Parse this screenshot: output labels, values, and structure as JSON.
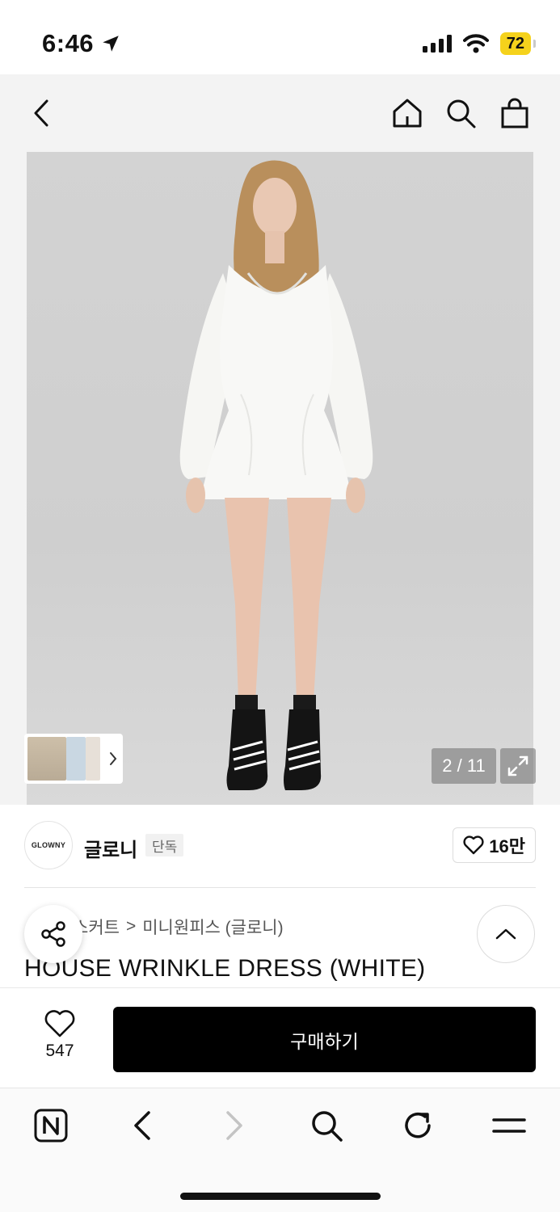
{
  "status_bar": {
    "time": "6:46",
    "battery": "72"
  },
  "gallery": {
    "counter": "2 / 11"
  },
  "brand": {
    "logo_text": "GLOWNY",
    "name": "글로니",
    "badge": "단독",
    "likes": "16만"
  },
  "breadcrumb": {
    "parts": [
      "스커트",
      ">",
      "미니원피스 (글로니)"
    ]
  },
  "product": {
    "title": "HOUSE WRINKLE DRESS (WHITE)"
  },
  "purchase": {
    "wish_count": "547",
    "buy_label": "구매하기"
  }
}
